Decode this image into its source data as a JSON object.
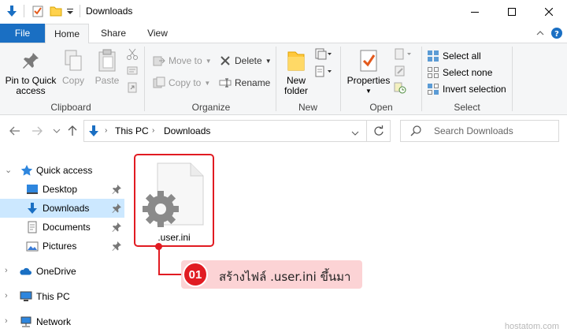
{
  "window": {
    "title": "Downloads"
  },
  "ribbon_tabs": [
    "File",
    "Home",
    "Share",
    "View"
  ],
  "ribbon": {
    "clipboard": {
      "label": "Clipboard",
      "pin_label_1": "Pin to Quick",
      "pin_label_2": "access",
      "copy": "Copy",
      "paste": "Paste"
    },
    "organize": {
      "label": "Organize",
      "move_to": "Move to",
      "copy_to": "Copy to",
      "delete": "Delete",
      "rename": "Rename"
    },
    "new": {
      "label": "New",
      "new_folder_1": "New",
      "new_folder_2": "folder"
    },
    "open": {
      "label": "Open",
      "properties": "Properties"
    },
    "select": {
      "label": "Select",
      "select_all": "Select all",
      "select_none": "Select none",
      "invert": "Invert selection"
    }
  },
  "address": {
    "crumbs": [
      "This PC",
      "Downloads"
    ],
    "search_placeholder": "Search Downloads"
  },
  "nav": {
    "quick_access": "Quick access",
    "items": [
      "Desktop",
      "Downloads",
      "Documents",
      "Pictures"
    ],
    "onedrive": "OneDrive",
    "this_pc": "This PC",
    "network": "Network"
  },
  "files": [
    {
      "name": ".user.ini"
    }
  ],
  "callout": {
    "number": "01",
    "text": "สร้างไฟล์ .user.ini ขึ้นมา"
  },
  "watermark": "hostatom.com",
  "colors": {
    "accent": "#1a6fc3",
    "highlight": "#e11b22",
    "callout_bg": "#fcd3d5",
    "selection": "#cce8ff"
  }
}
